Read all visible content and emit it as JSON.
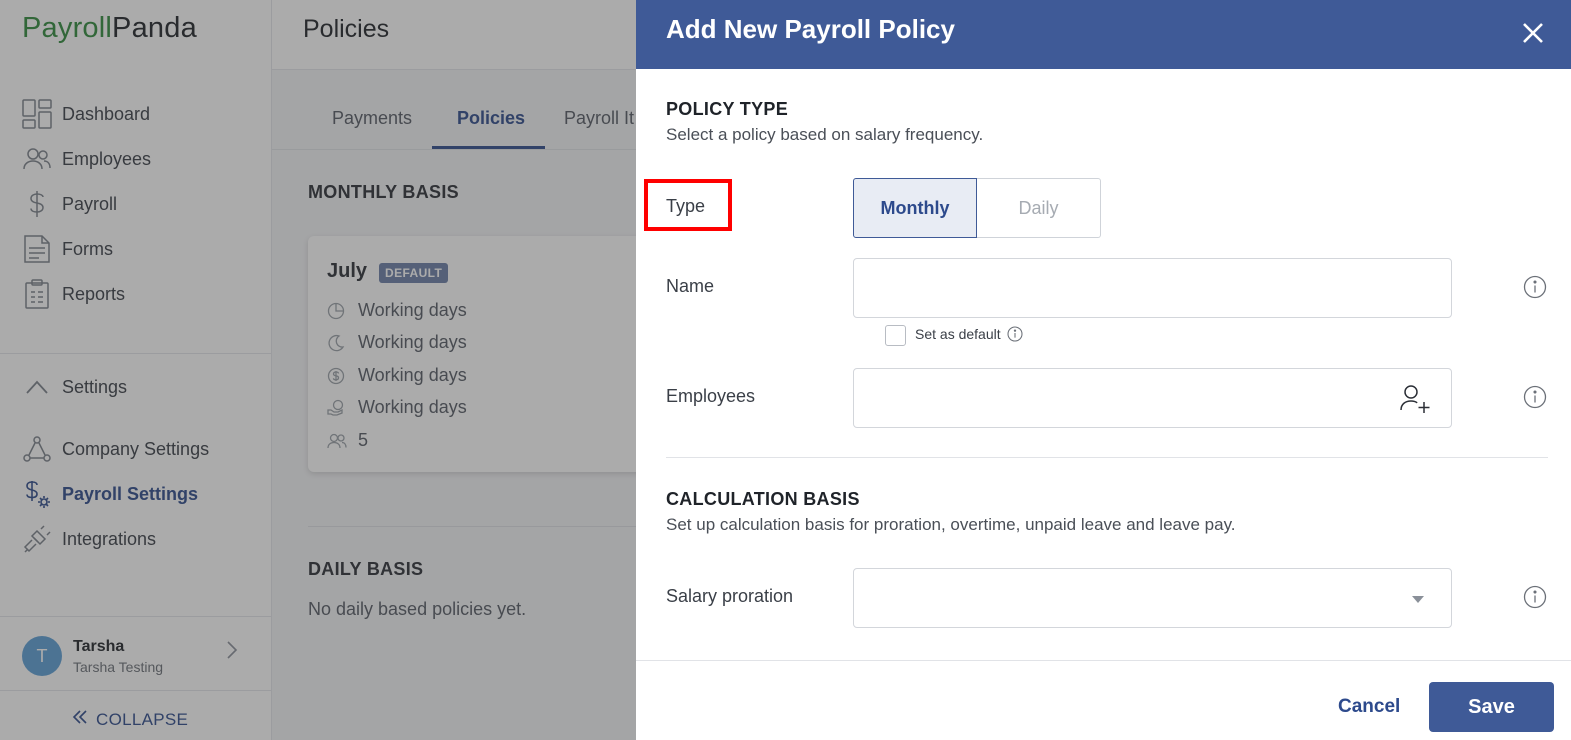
{
  "brand": {
    "part1": "Payroll",
    "part2": "Panda"
  },
  "nav": {
    "items": [
      {
        "label": "Dashboard",
        "icon": "dashboard-icon"
      },
      {
        "label": "Employees",
        "icon": "employees-icon"
      },
      {
        "label": "Payroll",
        "icon": "dollar-icon"
      },
      {
        "label": "Forms",
        "icon": "forms-icon"
      },
      {
        "label": "Reports",
        "icon": "reports-icon"
      }
    ],
    "settings_label": "Settings",
    "settings_items": [
      {
        "label": "Company Settings",
        "icon": "company-icon"
      },
      {
        "label": "Payroll Settings",
        "icon": "payroll-settings-icon"
      },
      {
        "label": "Integrations",
        "icon": "integrations-icon"
      }
    ]
  },
  "user": {
    "initial": "T",
    "name": "Tarsha",
    "org": "Tarsha Testing"
  },
  "collapse_label": "COLLAPSE",
  "page": {
    "title": "Policies",
    "tabs": [
      "Payments",
      "Policies",
      "Payroll It"
    ],
    "monthly_title": "MONTHLY BASIS",
    "card": {
      "title": "July",
      "badge": "DEFAULT",
      "rows": [
        "Working days",
        "Working days",
        "Working days",
        "Working days",
        "5"
      ]
    },
    "daily_title": "DAILY BASIS",
    "daily_empty": "No daily based policies yet."
  },
  "drawer": {
    "title": "Add New Payroll Policy",
    "policy_type_title": "POLICY TYPE",
    "policy_type_desc": "Select a policy based on salary frequency.",
    "type_label": "Type",
    "type_options": [
      "Monthly",
      "Daily"
    ],
    "type_selected": "Monthly",
    "name_label": "Name",
    "name_value": "",
    "default_label": "Set as default",
    "employees_label": "Employees",
    "calc_title": "CALCULATION BASIS",
    "calc_desc": "Set up calculation basis for proration, overtime, unpaid leave and leave pay.",
    "proration_label": "Salary proration",
    "cancel_label": "Cancel",
    "save_label": "Save"
  },
  "colors": {
    "accent": "#3f5a97",
    "brand_green": "#2f8a3c",
    "highlight": "#ff0000"
  }
}
